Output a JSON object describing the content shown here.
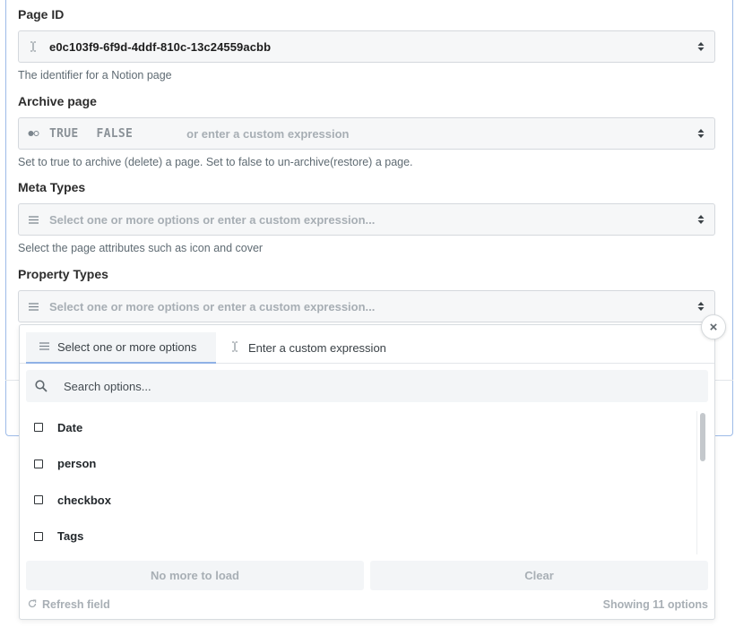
{
  "fields": {
    "page_id": {
      "label": "Page ID",
      "value": "e0c103f9-6f9d-4ddf-810c-13c24559acbb",
      "hint": "The identifier for a Notion page",
      "icon": "text-cursor-icon"
    },
    "archive": {
      "label": "Archive page",
      "option_true": "TRUE",
      "option_false": "FALSE",
      "placeholder": "or enter a custom expression",
      "hint": "Set to true to archive (delete) a page. Set to false to un-archive(restore) a page.",
      "icon": "toggle-icon"
    },
    "meta_types": {
      "label": "Meta Types",
      "placeholder": "Select one or more options or enter a custom expression...",
      "hint": "Select the page attributes such as icon and cover",
      "icon": "list-icon"
    },
    "property_types": {
      "label": "Property Types",
      "placeholder": "Select one or more options or enter a custom expression...",
      "icon": "list-icon"
    }
  },
  "dropdown": {
    "close": "×",
    "tabs": [
      {
        "label": "Select one or more options",
        "icon": "list-icon",
        "active": true
      },
      {
        "label": "Enter a custom expression",
        "icon": "text-cursor-icon",
        "active": false
      }
    ],
    "search_placeholder": "Search options...",
    "options": [
      "Date",
      "person",
      "checkbox",
      "Tags"
    ],
    "load_button": "No more to load",
    "clear_button": "Clear",
    "refresh_label": "Refresh field",
    "count_label": "Showing 11 options"
  },
  "colors": {
    "accent_outline": "#9dbbe8",
    "tab_underline": "#8fb1e6",
    "input_bg": "#f6f7f8"
  }
}
